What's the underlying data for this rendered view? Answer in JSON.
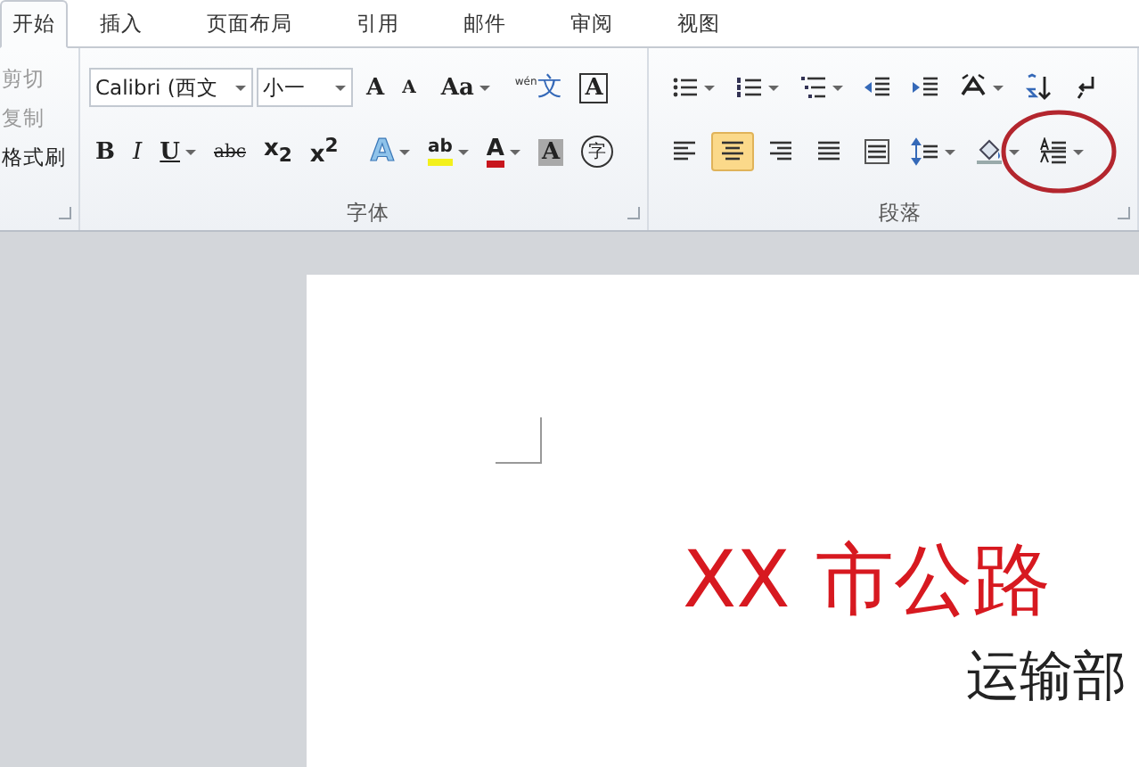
{
  "tabs": [
    {
      "label": "开始",
      "selected": true
    },
    {
      "label": "插入",
      "selected": false
    },
    {
      "label": "页面布局",
      "selected": false
    },
    {
      "label": "引用",
      "selected": false
    },
    {
      "label": "邮件",
      "selected": false
    },
    {
      "label": "审阅",
      "selected": false
    },
    {
      "label": "视图",
      "selected": false
    }
  ],
  "clipboard": {
    "items": [
      {
        "label": "剪切",
        "disabled": true
      },
      {
        "label": "复制",
        "disabled": true
      },
      {
        "label": "格式刷",
        "disabled": false
      }
    ]
  },
  "font": {
    "title": "字体",
    "font_name": "Calibri (西文",
    "font_size": "小一",
    "row1": [
      {
        "kind": "grow",
        "label": "A",
        "dropdown": false
      },
      {
        "kind": "shrink",
        "label": "A",
        "dropdown": false
      },
      {
        "kind": "case",
        "label": "Aa",
        "dropdown": true
      },
      {
        "kind": "pinyin",
        "label": "$^{wén}$文",
        "dropdown": false
      },
      {
        "kind": "boxed",
        "label": "A",
        "dropdown": false
      }
    ],
    "row2": [
      {
        "kind": "bold",
        "label": "B",
        "dropdown": false
      },
      {
        "kind": "italic",
        "label": "I",
        "dropdown": false
      },
      {
        "kind": "underline",
        "label": "U",
        "dropdown": true
      },
      {
        "kind": "strike",
        "label": "abc",
        "dropdown": false
      },
      {
        "kind": "script",
        "label": "x$_{2}$",
        "dropdown": false
      },
      {
        "kind": "script",
        "label": "x$^{2}$",
        "dropdown": false
      },
      {
        "kind": "effect",
        "label": "A",
        "dropdown": true
      },
      {
        "kind": "highlight",
        "label": "ab",
        "dropdown": true
      },
      {
        "kind": "color",
        "label": "A",
        "dropdown": true
      },
      {
        "kind": "shaded",
        "label": "A",
        "dropdown": false
      },
      {
        "kind": "enclosed",
        "label": "字",
        "dropdown": false
      }
    ]
  },
  "paragraph": {
    "title": "段落",
    "row1": [
      {
        "kind": "bullets",
        "dropdown": true
      },
      {
        "kind": "numbering",
        "dropdown": true
      },
      {
        "kind": "multilevel",
        "dropdown": true
      },
      {
        "kind": "outdent",
        "dropdown": false
      },
      {
        "kind": "indent",
        "dropdown": false
      },
      {
        "kind": "asian",
        "dropdown": true
      },
      {
        "kind": "sort",
        "dropdown": false
      },
      {
        "kind": "marks",
        "dropdown": false
      }
    ],
    "row2": [
      {
        "kind": "align-left",
        "dropdown": false,
        "selected": false
      },
      {
        "kind": "align-center",
        "dropdown": false,
        "selected": true
      },
      {
        "kind": "align-right",
        "dropdown": false,
        "selected": false
      },
      {
        "kind": "justify",
        "dropdown": false,
        "selected": false
      },
      {
        "kind": "distribute",
        "dropdown": false,
        "selected": false
      },
      {
        "kind": "line-spacing",
        "dropdown": true,
        "selected": false
      },
      {
        "kind": "shading",
        "dropdown": true,
        "selected": false
      },
      {
        "kind": "text-lines",
        "dropdown": true,
        "selected": false
      }
    ]
  },
  "document": {
    "title": "XX 市公路",
    "subtitle": "运输部"
  }
}
